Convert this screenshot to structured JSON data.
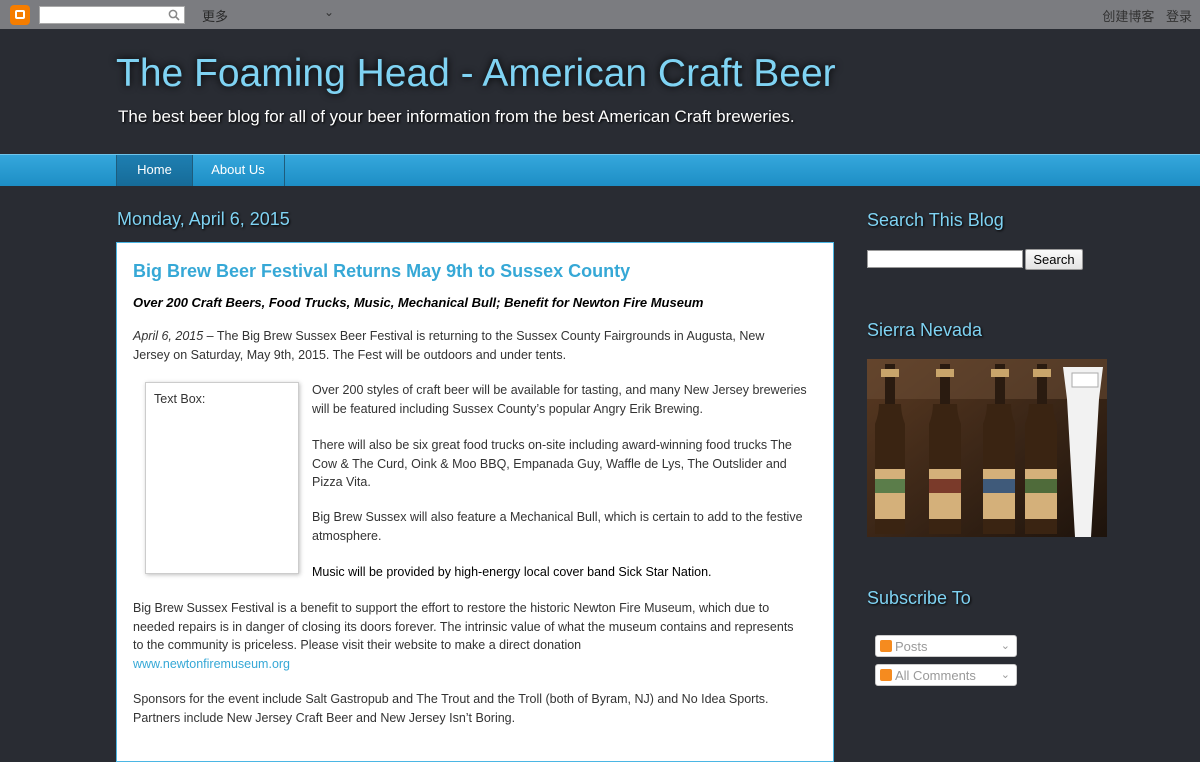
{
  "navbar": {
    "more_label": "更多",
    "create_blog": "创建博客",
    "login": "登录"
  },
  "header": {
    "title": "The Foaming Head - American Craft Beer",
    "description": "The best beer blog for all of your beer information from the best American Craft breweries."
  },
  "tabs": [
    {
      "label": "Home",
      "active": true
    },
    {
      "label": "About Us",
      "active": false
    }
  ],
  "main": {
    "date": "Monday, April 6, 2015",
    "post": {
      "title": "Big Brew Beer Festival Returns May 9th to Sussex County",
      "subtitle": "Over 200 Craft Beers, Food Trucks, Music, Mechanical Bull; Benefit for Newton Fire Museum",
      "date_em": "April 6, 2015",
      "intro": " – The Big Brew Sussex Beer Festival is returning to the Sussex County Fairgrounds in Augusta, New Jersey on Saturday, May 9th, 2015.  The Fest will be outdoors and under tents.",
      "textbox_alt": "Text Box:",
      "para1": "Over 200 styles of craft beer will be available for tasting, and many New Jersey breweries will be featured including Sussex County’s popular Angry Erik Brewing.",
      "para2": "There will also be six great food trucks on-site including award-winning food trucks The Cow & The Curd, Oink & Moo BBQ, Empanada Guy, Waffle de Lys, The Outslider and Pizza Vita.",
      "para3": "Big Brew Sussex will also feature a Mechanical Bull, which is certain to add to the festive atmosphere.",
      "para4": "Music will be provided by high-energy local cover band Sick Star Nation.",
      "para5": "Big Brew Sussex Festival is a benefit to support the effort to restore the historic Newton Fire Museum, which due to needed repairs is in danger of closing its doors forever.  The intrinsic value of what the museum contains and represents to the community is priceless. Please visit their website to make a direct donation",
      "link": "www.newtonfiremuseum.org",
      "para6": "Sponsors for the event include Salt Gastropub and The Trout and the Troll (both of Byram, NJ) and No Idea Sports. Partners include New Jersey Craft Beer and New Jersey Isn’t Boring."
    }
  },
  "sidebar": {
    "search_title": "Search This Blog",
    "search_button": "Search",
    "sierra_title": "Sierra Nevada",
    "subscribe_title": "Subscribe To",
    "subscribe_items": [
      "Posts",
      "All Comments"
    ]
  },
  "colors": {
    "accent": "#7fd3f3",
    "link": "#36a8d6",
    "tabs": "#29a0d8",
    "background": "#292c33"
  }
}
